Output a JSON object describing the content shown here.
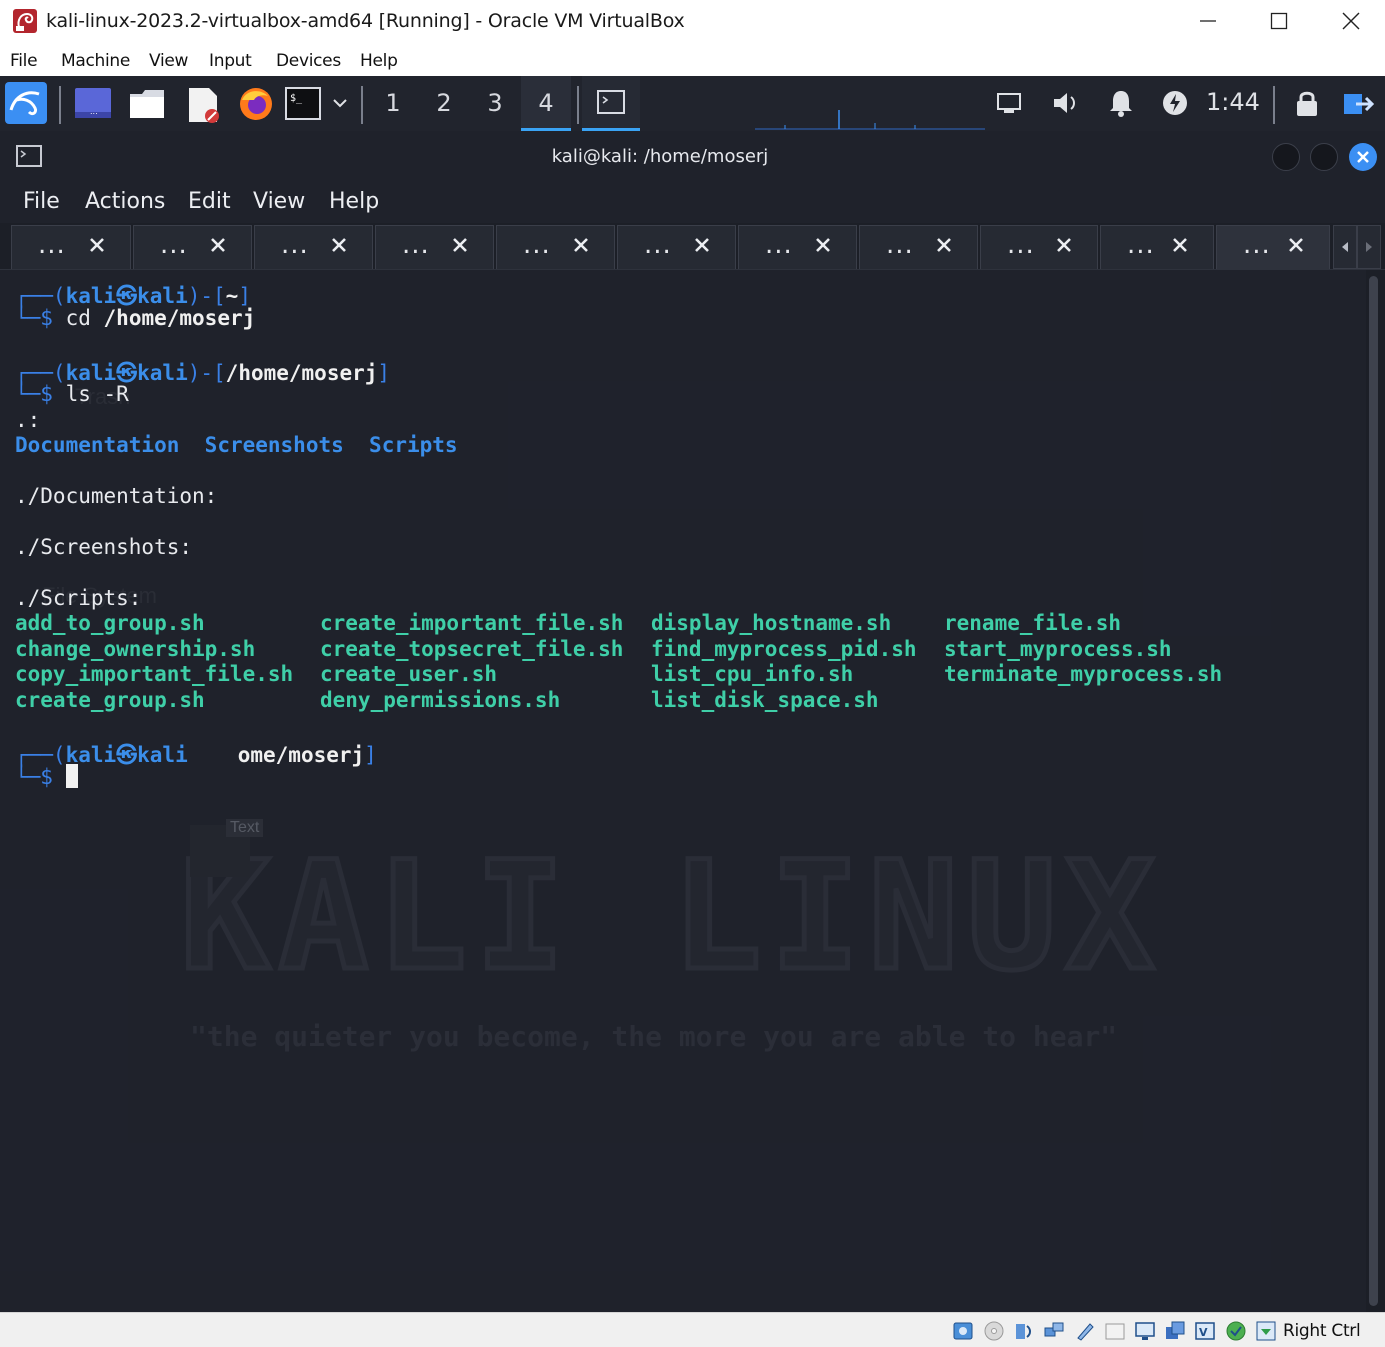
{
  "host": {
    "title": "kali-linux-2023.2-virtualbox-amd64 [Running] - Oracle VM VirtualBox",
    "menu": [
      "File",
      "Machine",
      "View",
      "Input",
      "Devices",
      "Help"
    ],
    "status_right_label": "Right Ctrl",
    "status_icons": [
      "hard-disk-icon",
      "optical-drive-icon",
      "audio-icon",
      "network-icon",
      "usb-icon",
      "shared-folders-icon",
      "display-icon",
      "recording-icon",
      "cpu-icon",
      "guest-additions-icon",
      "mouse-integration-icon",
      "keyboard-icon"
    ]
  },
  "panel": {
    "workspaces": [
      "1",
      "2",
      "3",
      "4"
    ],
    "active_workspace": "4",
    "clock": "1:44"
  },
  "terminal": {
    "window_title": "kali@kali: /home/moserj",
    "menu": [
      "File",
      "Actions",
      "Edit",
      "View",
      "Help"
    ],
    "tab_label": "...",
    "tab_count": 11,
    "lines": {
      "p1_open": "┌──(",
      "p1_user": "kali㉿kali",
      "p1_mid": ")-[",
      "p1_path": "~",
      "p1_close": "]",
      "c1_prefix": "└─$ ",
      "c1_cmd": "cd",
      "c1_arg": "/home/moserj",
      "p2_open": "┌──(",
      "p2_user": "kali㉿kali",
      "p2_mid": ")-[",
      "p2_path": "/home/moserj",
      "p2_close": "]",
      "c2_prefix": "└─$ ",
      "c2_cmd": "ls -R",
      "dot": ".:",
      "dirs": [
        "Documentation",
        "Screenshots",
        "Scripts"
      ],
      "doc_header": "./Documentation:",
      "shots_header": "./Screenshots:",
      "scripts_header": "./Scripts:",
      "p3_open": "┌──(",
      "p3_user": "kali㉿kali",
      "p3_path_visible": "ome/moserj",
      "p3_close": "]",
      "c3_prefix": "└─$ "
    },
    "scripts": [
      [
        "add_to_group.sh",
        "create_important_file.sh",
        "display_hostname.sh",
        "rename_file.sh"
      ],
      [
        "change_ownership.sh",
        "create_topsecret_file.sh",
        "find_myprocess_pid.sh",
        "start_myprocess.sh"
      ],
      [
        "copy_important_file.sh",
        "create_user.sh",
        "list_cpu_info.sh",
        "terminate_myprocess.sh"
      ],
      [
        "create_group.sh",
        "deny_permissions.sh",
        "list_disk_space.sh",
        ""
      ]
    ]
  },
  "wallpaper": {
    "logo_text": "KALI LINUX",
    "quote": "\"the quieter you become, the more you are able to hear\"",
    "ghost_labels": [
      "Trash",
      "File System",
      "Text"
    ]
  },
  "colors": {
    "terminal_bg": "#1f222c",
    "prompt_blue": "#3b8eea",
    "script_green": "#3fcfa8",
    "accent": "#3aa3f4"
  }
}
